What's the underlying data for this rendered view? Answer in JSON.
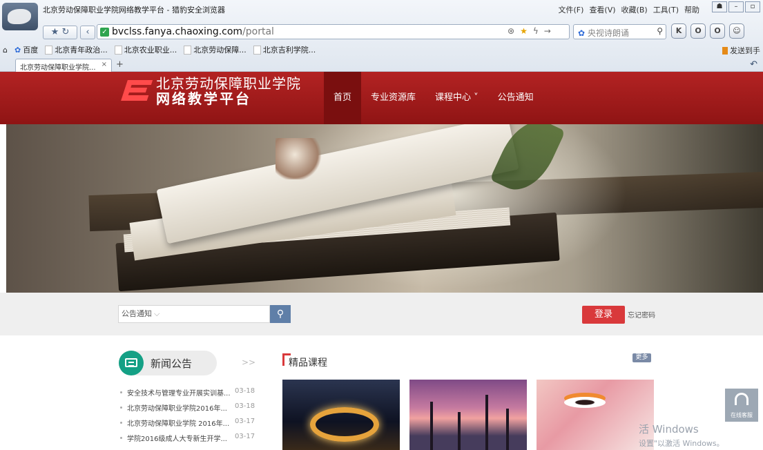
{
  "browser": {
    "title": "北京劳动保障职业学院网络教学平台 - 猎豹安全浏览器",
    "menu": [
      "文件(F)",
      "查看(V)",
      "收藏(B)",
      "工具(T)",
      "帮助"
    ],
    "url_host": "bvclss.fanya.chaoxing.com",
    "url_path": "/portal",
    "search_placeholder": "央视诗朗诵",
    "bookmarks": [
      "百度",
      "北京青年政治...",
      "北京农业职业...",
      "北京劳动保障...",
      "北京吉利学院..."
    ],
    "bookmark_right": "发送到手",
    "tab_label": "北京劳动保障职业学院...",
    "tab_close": "×",
    "new_tab": "+"
  },
  "site": {
    "name_line1": "北京劳动保障职业学院",
    "name_line2": "网络教学平台",
    "nav": [
      {
        "label": "首页",
        "active": true
      },
      {
        "label": "专业资源库"
      },
      {
        "label": "课程中心 ˅"
      },
      {
        "label": "公告通知"
      }
    ]
  },
  "search": {
    "category": "公告通知",
    "button_icon": "search-icon",
    "login_label": "登录",
    "forgot_label": "忘记密码"
  },
  "news": {
    "title": "新闻公告",
    "more": ">>",
    "items": [
      {
        "title": "安全技术与管理专业开展实训基...",
        "date": "03-18"
      },
      {
        "title": "北京劳动保障职业学院2016年...",
        "date": "03-18"
      },
      {
        "title": "北京劳动保障职业学院 2016年...",
        "date": "03-17"
      },
      {
        "title": "学院2016级成人大专新生开学...",
        "date": "03-17"
      }
    ]
  },
  "courses": {
    "title": "精品课程",
    "more": "更多"
  },
  "service": {
    "label": "在线客服"
  },
  "watermark": {
    "line1": "活 Windows",
    "line2": "设置\"以激活 Windows。"
  },
  "colors": {
    "brand_red": "#a51c1c",
    "login_red": "#d9393b",
    "news_green": "#14a085"
  }
}
